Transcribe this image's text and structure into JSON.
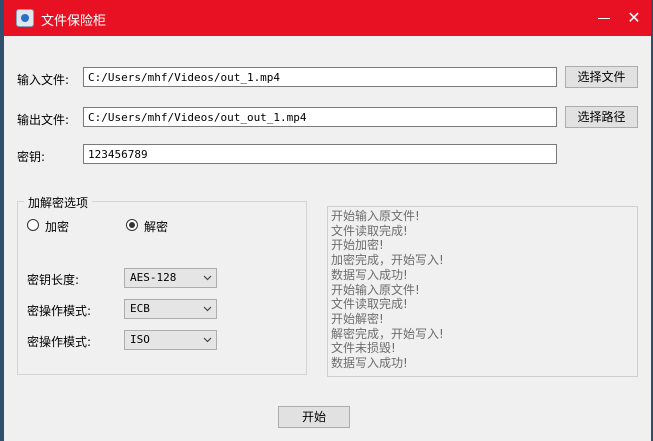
{
  "window": {
    "title": "文件保险柜",
    "minimize": "—",
    "close": "✕"
  },
  "form": {
    "input_label": "输入文件:",
    "input_value": "C:/Users/mhf/Videos/out_1.mp4",
    "choose_file_label": "选择文件",
    "output_label": "输出文件:",
    "output_value": "C:/Users/mhf/Videos/out_out_1.mp4",
    "choose_path_label": "选择路径",
    "key_label": "密钥:",
    "key_value": "123456789"
  },
  "options": {
    "group_title": "加解密选项",
    "encrypt_label": "加密",
    "decrypt_label": "解密",
    "selected": "decrypt",
    "key_length_label": "密钥长度:",
    "key_length_value": "AES-128",
    "mode_label": "密操作模式:",
    "mode_value": "ECB",
    "padding_label": "密操作模式:",
    "padding_value": "ISO"
  },
  "log": [
    "开始输入原文件!",
    "文件读取完成!",
    "开始加密!",
    "加密完成，开始写入!",
    "数据写入成功!",
    "开始输入原文件!",
    "文件读取完成!",
    "开始解密!",
    "解密完成，开始写入!",
    "文件未损毁!",
    "数据写入成功!"
  ],
  "start_label": "开始",
  "colors": {
    "titlebar": "#e81123",
    "window": "#f0f0f0",
    "log_text": "#6d6d6d"
  },
  "icons": [
    "app-icon",
    "minimize-icon",
    "close-icon",
    "chevron-down-icon"
  ]
}
